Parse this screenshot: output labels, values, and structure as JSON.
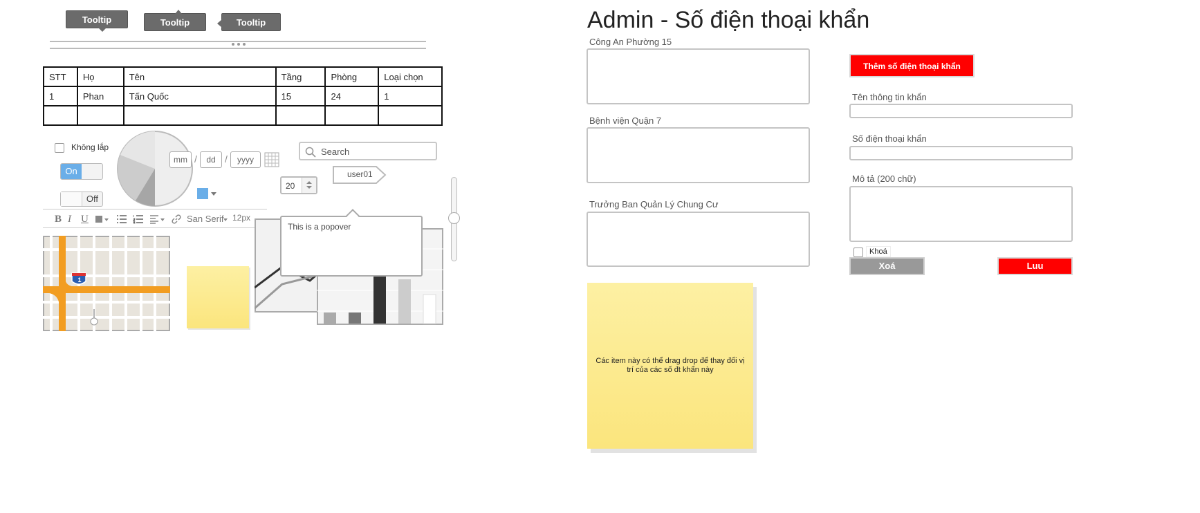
{
  "tooltips": [
    "Tooltip",
    "Tooltip",
    "Tooltip"
  ],
  "table": {
    "headers": [
      "STT",
      "Họ",
      "Tên",
      "Tầng",
      "Phòng",
      "Loại chọn"
    ],
    "rows": [
      [
        "1",
        "Phan",
        "Tấn Quốc",
        "15",
        "24",
        "1"
      ],
      [
        "",
        "",
        "",
        "",
        "",
        ""
      ]
    ]
  },
  "checkbox_label": "Không lắp",
  "toggle_on": "On",
  "toggle_off": "Off",
  "date": {
    "mm": "mm",
    "dd": "dd",
    "yyyy": "yyyy",
    "sep": "/"
  },
  "search": {
    "placeholder": "Search"
  },
  "stepper_value": "20",
  "user_tag": "user01",
  "popover_text": "This is a popover",
  "editor": {
    "font": "San Serif",
    "size": "12px",
    "bold": "B",
    "italic": "I",
    "underline": "U"
  },
  "map_shield": "1",
  "admin": {
    "title": "Admin - Số điện thoại khẩn",
    "contacts": [
      "Công An Phường 15",
      "Bệnh viện Quận 7",
      "Trưởng Ban Quản Lý Chung Cư"
    ],
    "add_button": "Thêm số điện thoại khẩn",
    "name_label": "Tên thông tin khẩn",
    "phone_label": "Số điện thoại khẩn",
    "desc_label": "Mô tả (200 chữ)",
    "lock_label": "Khoá",
    "delete_button": "Xoá",
    "save_button": "Luu",
    "sticky_note": "Các item này có thể drag drop để thay đổi vị trí của các số đt khẩn này"
  },
  "colors": {
    "accent_red": "#ff0000",
    "toggle_blue": "#6aaee8",
    "delete_gray": "#999999"
  }
}
